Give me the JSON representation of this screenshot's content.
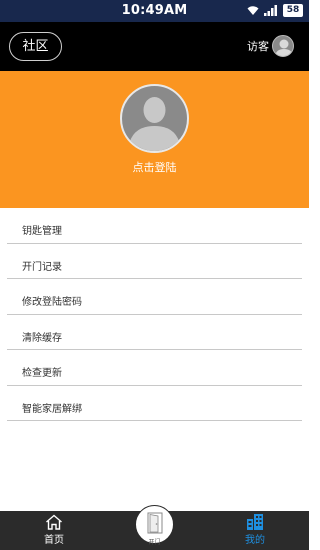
{
  "status_bar": {
    "time": "10:49AM",
    "battery": "58"
  },
  "header": {
    "community_label": "社区",
    "visitor_label": "访客"
  },
  "profile": {
    "login_label": "点击登陆"
  },
  "menu": {
    "items": [
      {
        "label": "钥匙管理"
      },
      {
        "label": "开门记录"
      },
      {
        "label": "修改登陆密码"
      },
      {
        "label": "清除缓存"
      },
      {
        "label": "检查更新"
      },
      {
        "label": "智能家居解绑"
      }
    ]
  },
  "tabbar": {
    "home_label": "首页",
    "open_door_label": "开门",
    "mine_label": "我的",
    "active_color": "#1e8fe0"
  },
  "colors": {
    "status_bar": "#18284d",
    "header": "#000000",
    "banner": "#fb9520",
    "tabbar": "#2b2b2b"
  },
  "icons": {
    "wifi": "wifi-icon",
    "signal": "signal-icon",
    "battery": "battery-icon",
    "avatar": "default-avatar-icon",
    "home": "home-icon",
    "door": "door-icon",
    "mine": "building-icon"
  }
}
